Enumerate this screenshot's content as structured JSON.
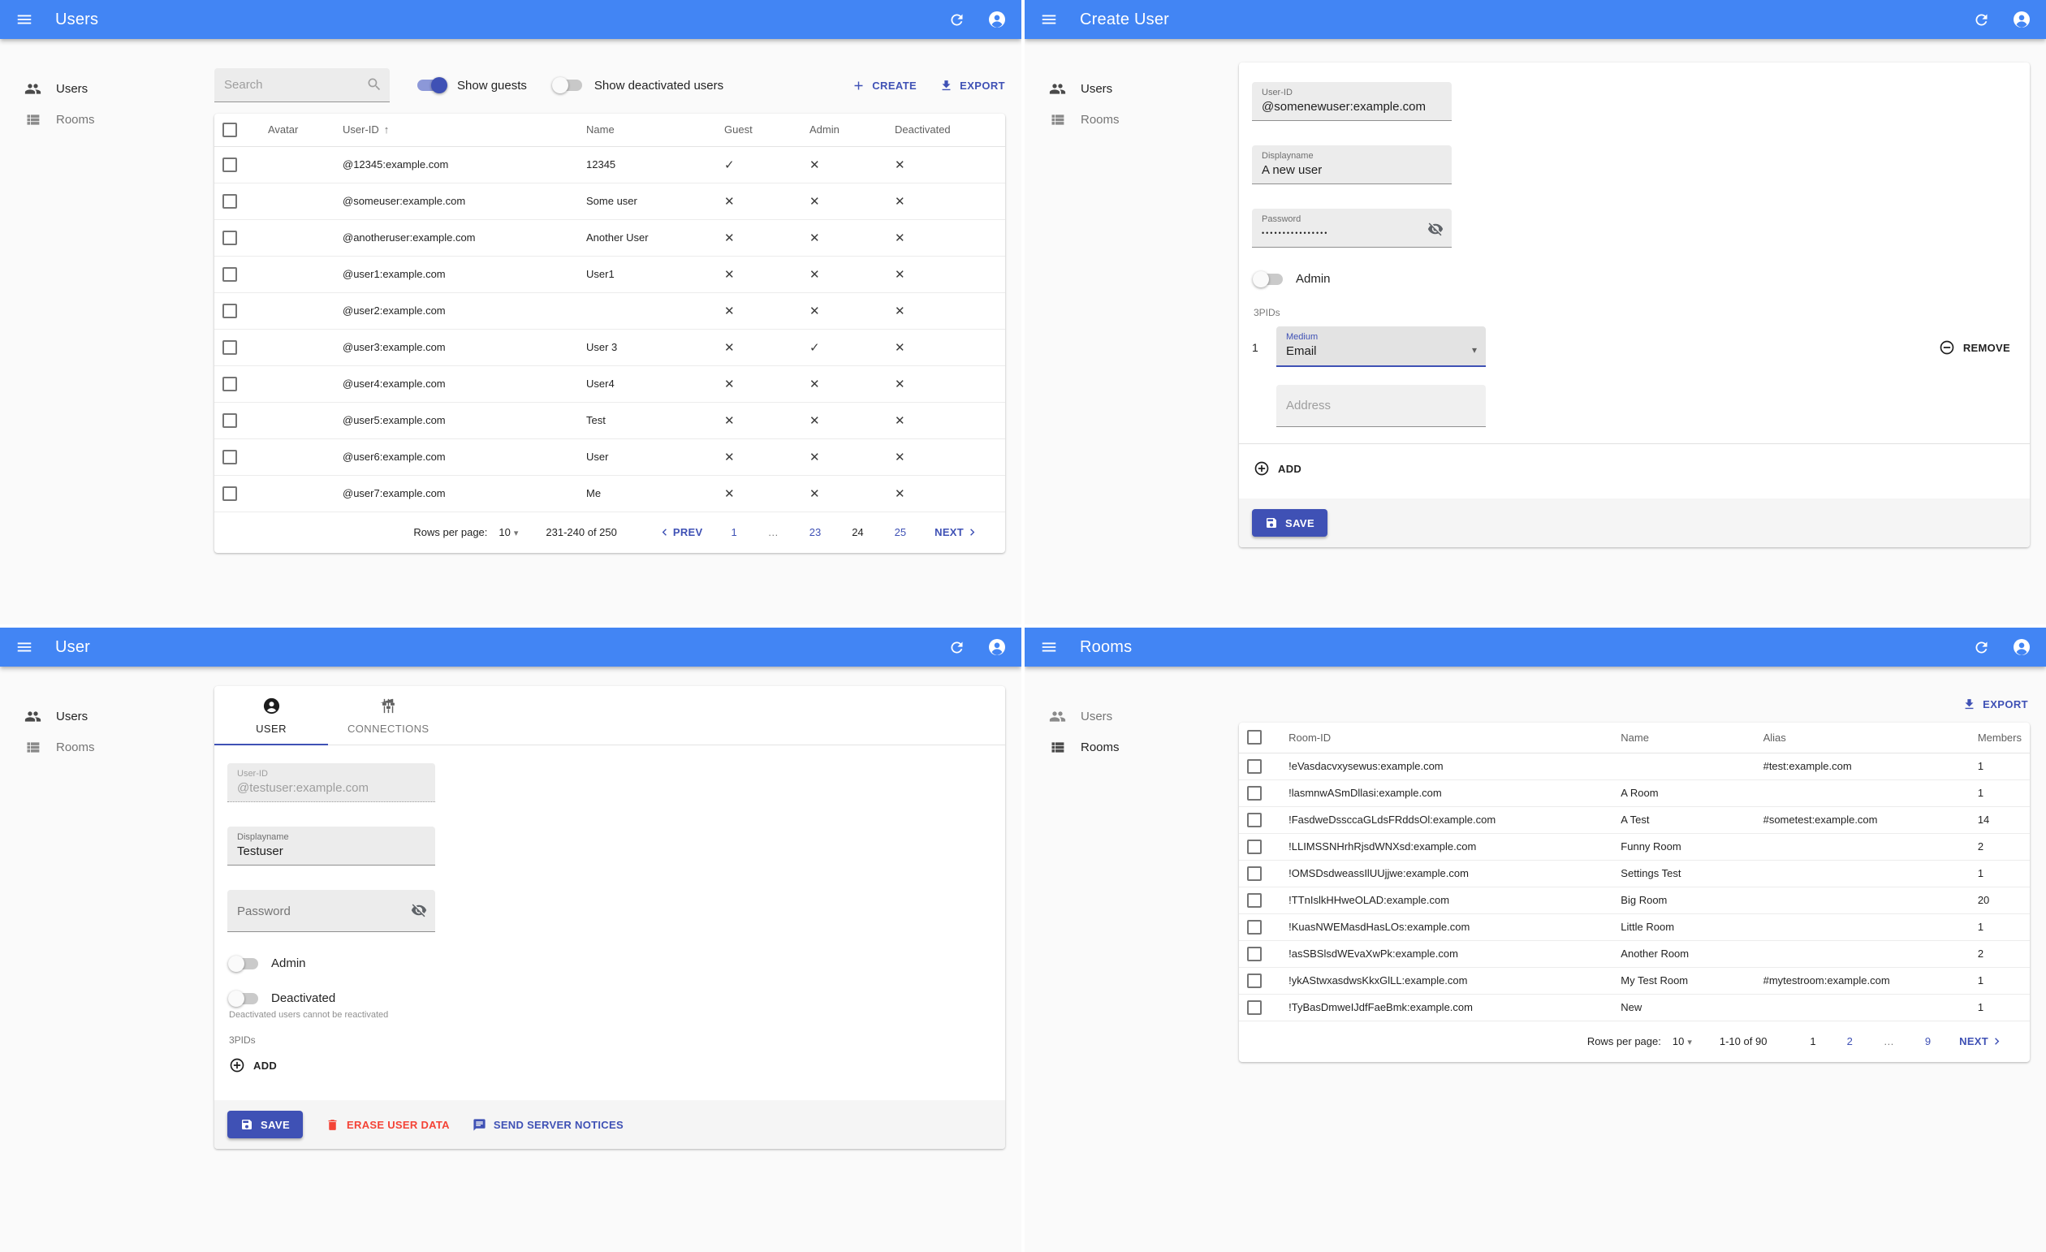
{
  "shared": {
    "sidebar": {
      "users": "Users",
      "rooms": "Rooms"
    },
    "icons": {
      "check": "✓",
      "cross": "✕",
      "sort_asc": "↑",
      "dropdown": "▾",
      "ellipsis": "…"
    },
    "colors": {
      "appbar_blue": "#4285f4",
      "primary_indigo": "#3f51b5",
      "danger_red": "#f44336",
      "page_bg": "#fafafa"
    }
  },
  "users_list": {
    "appbar_title": "Users",
    "search_placeholder": "Search",
    "show_guests_label": "Show guests",
    "show_deactivated_label": "Show deactivated users",
    "create_label": "CREATE",
    "export_label": "EXPORT",
    "table": {
      "headers": [
        "Avatar",
        "User-ID",
        "Name",
        "Guest",
        "Admin",
        "Deactivated"
      ],
      "rows": [
        {
          "user_id": "@12345:example.com",
          "name": "12345",
          "guest": true,
          "admin": false,
          "deactivated": false
        },
        {
          "user_id": "@someuser:example.com",
          "name": "Some user",
          "guest": false,
          "admin": false,
          "deactivated": false
        },
        {
          "user_id": "@anotheruser:example.com",
          "name": "Another User",
          "guest": false,
          "admin": false,
          "deactivated": false
        },
        {
          "user_id": "@user1:example.com",
          "name": "User1",
          "guest": false,
          "admin": false,
          "deactivated": false
        },
        {
          "user_id": "@user2:example.com",
          "name": "",
          "guest": false,
          "admin": false,
          "deactivated": false
        },
        {
          "user_id": "@user3:example.com",
          "name": "User 3",
          "guest": false,
          "admin": true,
          "deactivated": false
        },
        {
          "user_id": "@user4:example.com",
          "name": "User4",
          "guest": false,
          "admin": false,
          "deactivated": false
        },
        {
          "user_id": "@user5:example.com",
          "name": "Test",
          "guest": false,
          "admin": false,
          "deactivated": false
        },
        {
          "user_id": "@user6:example.com",
          "name": "User",
          "guest": false,
          "admin": false,
          "deactivated": false
        },
        {
          "user_id": "@user7:example.com",
          "name": "Me",
          "guest": false,
          "admin": false,
          "deactivated": false
        }
      ]
    },
    "pagination": {
      "rows_per_page_label": "Rows per page:",
      "rows_per_page": "10",
      "range": "231-240 of 250",
      "prev_label": "PREV",
      "next_label": "NEXT",
      "pages": [
        {
          "label": "1"
        },
        {
          "label": "…",
          "ellipsis": true
        },
        {
          "label": "23"
        },
        {
          "label": "24",
          "current": true
        },
        {
          "label": "25"
        }
      ]
    }
  },
  "create_user": {
    "appbar_title": "Create User",
    "user_id_label": "User-ID",
    "user_id_value": "@somenewuser:example.com",
    "displayname_label": "Displayname",
    "displayname_value": "A new user",
    "password_label": "Password",
    "password_value": "••••••••••••••••",
    "admin_label": "Admin",
    "threepids_label": "3PIDs",
    "row_number": "1",
    "medium_label": "Medium",
    "medium_value": "Email",
    "remove_label": "REMOVE",
    "address_placeholder": "Address",
    "add_label": "ADD",
    "save_label": "SAVE"
  },
  "user_edit": {
    "appbar_title": "User",
    "tabs": {
      "user": "USER",
      "connections": "CONNECTIONS"
    },
    "user_id_label": "User-ID",
    "user_id_value": "@testuser:example.com",
    "displayname_label": "Displayname",
    "displayname_value": "Testuser",
    "password_placeholder": "Password",
    "admin_label": "Admin",
    "deactivated_label": "Deactivated",
    "deactivated_helper": "Deactivated users cannot be reactivated",
    "threepids_label": "3PIDs",
    "add_label": "ADD",
    "save_label": "SAVE",
    "erase_label": "ERASE USER DATA",
    "notices_label": "SEND SERVER NOTICES"
  },
  "rooms_list": {
    "appbar_title": "Rooms",
    "export_label": "EXPORT",
    "table": {
      "headers": [
        "Room-ID",
        "Name",
        "Alias",
        "Members"
      ],
      "rows": [
        {
          "room_id": "!eVasdacvxysewus:example.com",
          "name": "",
          "alias": "#test:example.com",
          "members": "1"
        },
        {
          "room_id": "!lasmnwASmDllasi:example.com",
          "name": "A Room",
          "alias": "",
          "members": "1"
        },
        {
          "room_id": "!FasdweDssccaGLdsFRddsOl:example.com",
          "name": "A Test",
          "alias": "#sometest:example.com",
          "members": "14"
        },
        {
          "room_id": "!LLIMSSNHrhRjsdWNXsd:example.com",
          "name": "Funny Room",
          "alias": "",
          "members": "2"
        },
        {
          "room_id": "!OMSDsdweassIlUUjjwe:example.com",
          "name": "Settings Test",
          "alias": "",
          "members": "1"
        },
        {
          "room_id": "!TTnIslkHHweOLAD:example.com",
          "name": "Big Room",
          "alias": "",
          "members": "20"
        },
        {
          "room_id": "!KuasNWEMasdHasLOs:example.com",
          "name": "Little Room",
          "alias": "",
          "members": "1"
        },
        {
          "room_id": "!asSBSlsdWEvaXwPk:example.com",
          "name": "Another Room",
          "alias": "",
          "members": "2"
        },
        {
          "room_id": "!ykAStwxasdwsKkxGlLL:example.com",
          "name": "My Test Room",
          "alias": "#mytestroom:example.com",
          "members": "1"
        },
        {
          "room_id": "!TyBasDmweIJdfFaeBmk:example.com",
          "name": "New",
          "alias": "",
          "members": "1"
        }
      ]
    },
    "pagination": {
      "rows_per_page_label": "Rows per page:",
      "rows_per_page": "10",
      "range": "1-10 of 90",
      "next_label": "NEXT",
      "pages": [
        {
          "label": "1",
          "current": true
        },
        {
          "label": "2"
        },
        {
          "label": "…",
          "ellipsis": true
        },
        {
          "label": "9"
        }
      ]
    }
  }
}
